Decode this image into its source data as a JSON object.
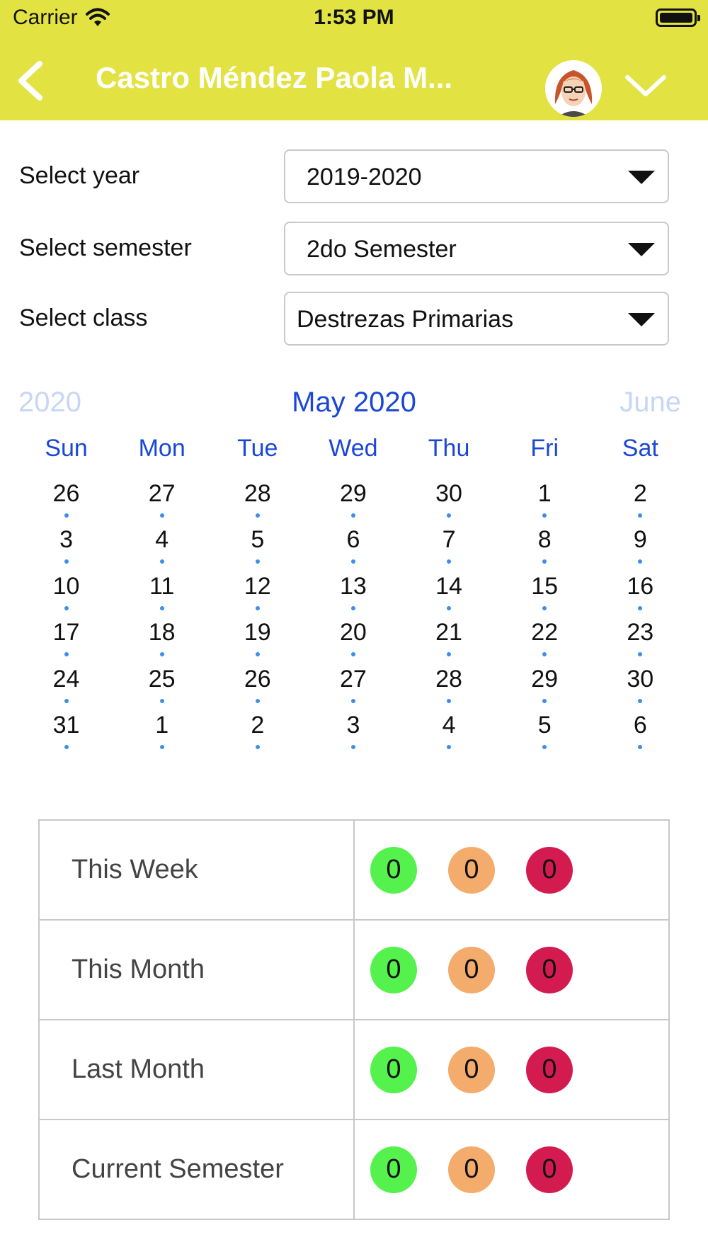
{
  "status_bar": {
    "carrier": "Carrier",
    "time": "1:53 PM"
  },
  "header": {
    "title": "Castro Méndez Paola M...",
    "bg_color": "#e2e243"
  },
  "filters": {
    "year_label": "Select year",
    "year_value": "2019-2020",
    "semester_label": "Select semester",
    "semester_value": "2do Semester",
    "class_label": "Select class",
    "class_value": "Destrezas Primarias"
  },
  "calendar": {
    "prev_label": "2020",
    "current_label": "May 2020",
    "next_label": "June",
    "weekdays": [
      "Sun",
      "Mon",
      "Tue",
      "Wed",
      "Thu",
      "Fri",
      "Sat"
    ],
    "weeks": [
      [
        "26",
        "27",
        "28",
        "29",
        "30",
        "1",
        "2"
      ],
      [
        "3",
        "4",
        "5",
        "6",
        "7",
        "8",
        "9"
      ],
      [
        "10",
        "11",
        "12",
        "13",
        "14",
        "15",
        "16"
      ],
      [
        "17",
        "18",
        "19",
        "20",
        "21",
        "22",
        "23"
      ],
      [
        "24",
        "25",
        "26",
        "27",
        "28",
        "29",
        "30"
      ],
      [
        "31",
        "1",
        "2",
        "3",
        "4",
        "5",
        "6"
      ]
    ],
    "accent_color": "#1a47d8",
    "dot_color": "#3d8ee8"
  },
  "summary": {
    "status_colors": {
      "green": "#55f24d",
      "orange": "#f4ac6c",
      "red": "#d31b4f"
    },
    "rows": [
      {
        "label": "This Week",
        "green": "0",
        "orange": "0",
        "red": "0"
      },
      {
        "label": "This Month",
        "green": "0",
        "orange": "0",
        "red": "0"
      },
      {
        "label": "Last Month",
        "green": "0",
        "orange": "0",
        "red": "0"
      },
      {
        "label": "Current Semester",
        "green": "0",
        "orange": "0",
        "red": "0"
      }
    ]
  },
  "icons": {
    "back": "chevron-left-icon",
    "menu": "chevron-down-icon",
    "avatar": "user-avatar",
    "wifi": "wifi-icon",
    "battery": "battery-icon"
  }
}
